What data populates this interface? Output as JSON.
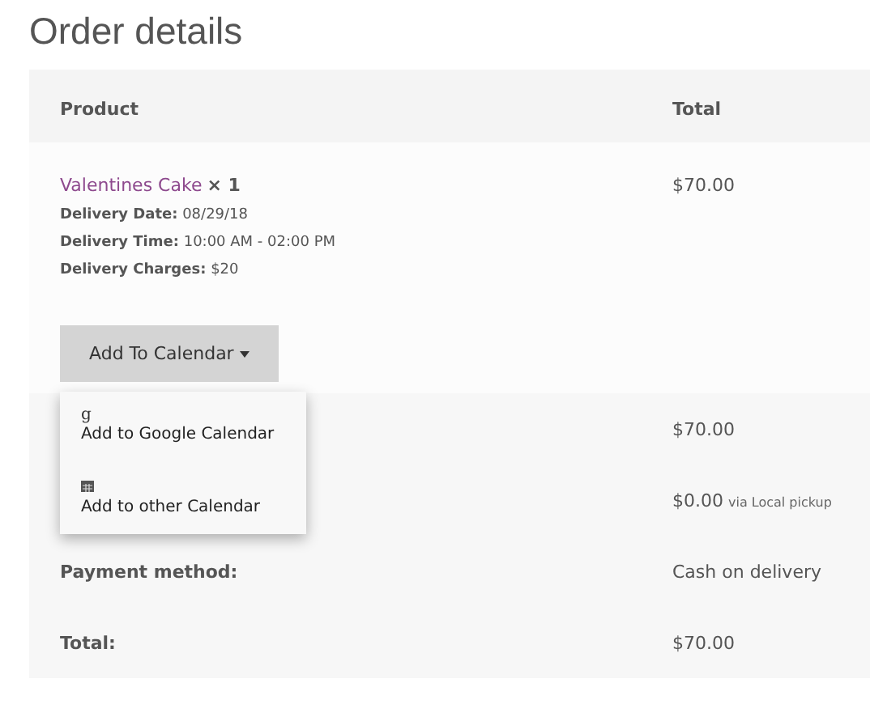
{
  "title": "Order details",
  "columns": [
    "Product",
    "Total"
  ],
  "item": {
    "name": "Valentines Cake",
    "quantity": "× 1",
    "meta": [
      {
        "label": "Delivery Date:",
        "value": "08/29/18"
      },
      {
        "label": "Delivery Time:",
        "value": "10:00 AM - 02:00 PM"
      },
      {
        "label": "Delivery Charges:",
        "value": "$20"
      }
    ],
    "total": "$70.00"
  },
  "calendar_button": {
    "label": "Add To Calendar",
    "expanded": true,
    "options": [
      {
        "kind": "google",
        "icon": "g",
        "label": "Add to Google Calendar"
      },
      {
        "kind": "other",
        "label": "Add to other Calendar"
      }
    ]
  },
  "totals": [
    {
      "value": "$70.00"
    },
    {
      "value": "$0.00",
      "note": "via Local pickup"
    },
    {
      "label": "Payment method:",
      "value": "Cash on delivery"
    },
    {
      "label": "Total:",
      "value": "$70.00"
    }
  ]
}
